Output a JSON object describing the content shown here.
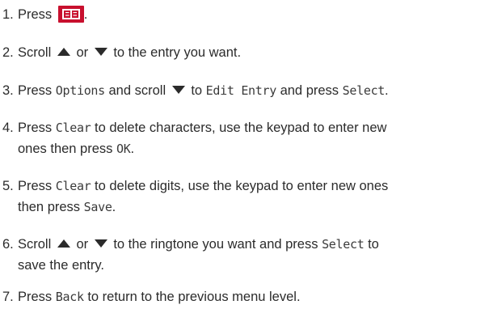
{
  "steps": [
    {
      "num": "1.",
      "t1": "Press",
      "icon": "phonebook-key-icon",
      "t2": "."
    },
    {
      "num": "2.",
      "t1": "Scroll",
      "icon_up": "up-arrow-icon",
      "t2": "or",
      "icon_down": "down-arrow-icon",
      "t3": "to the entry you want."
    },
    {
      "num": "3.",
      "t1": "Press",
      "d1": "Options",
      "t2": "and scroll",
      "icon_down": "down-arrow-icon",
      "t3": "to",
      "d2": "Edit Entry",
      "t4": "and press",
      "d3": "Select",
      "t5": "."
    },
    {
      "num": "4.",
      "t1": "Press",
      "d1": "Clear",
      "t2": "to delete characters, use the keypad to enter new",
      "t3": "ones then press",
      "d2": "OK",
      "t4": "."
    },
    {
      "num": "5.",
      "t1": "Press",
      "d1": "Clear",
      "t2": "to delete digits, use the keypad to enter new ones",
      "t3": "then press",
      "d2": "Save",
      "t4": "."
    },
    {
      "num": "6.",
      "t1": "Scroll",
      "icon_up": "up-arrow-icon",
      "t2": "or",
      "icon_down": "down-arrow-icon",
      "t3": "to the ringtone you want and press",
      "d1": "Select",
      "t4": "to",
      "t5": "save the entry."
    },
    {
      "num": "7.",
      "t1": "Press",
      "d1": "Back",
      "t2": "to return to the previous menu level."
    }
  ],
  "colors": {
    "text": "#2b2b2b",
    "key_background": "#c8102e",
    "key_glyph": "#ffffff"
  }
}
